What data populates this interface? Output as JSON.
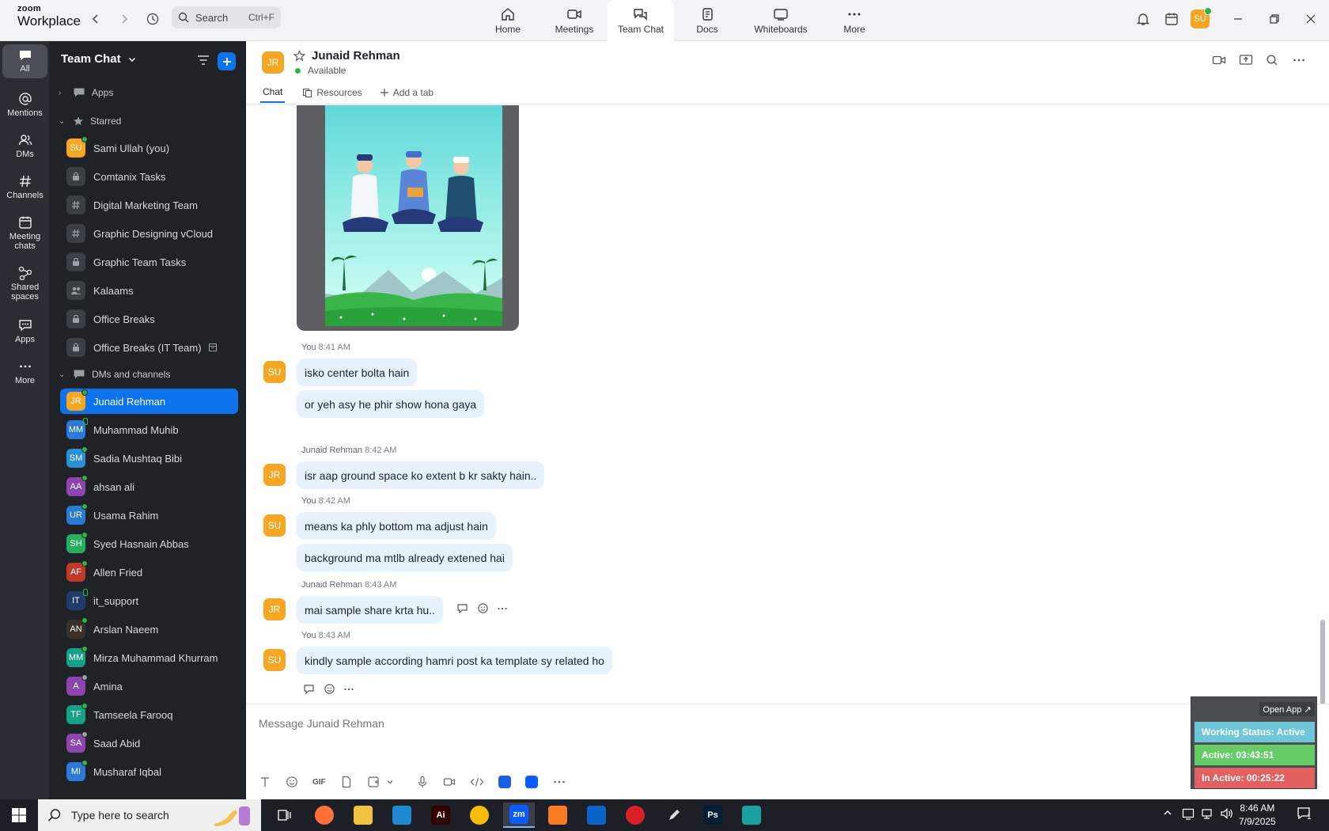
{
  "app": {
    "logo_line1": "zoom",
    "logo_line2": "Workplace",
    "search_placeholder": "Search",
    "search_shortcut": "Ctrl+F",
    "user_initials": "SU"
  },
  "nav_tabs": [
    {
      "label": "Home",
      "icon": "home-icon"
    },
    {
      "label": "Meetings",
      "icon": "video-icon"
    },
    {
      "label": "Team Chat",
      "icon": "chat-icon",
      "active": true
    },
    {
      "label": "Docs",
      "icon": "doc-icon"
    },
    {
      "label": "Whiteboards",
      "icon": "whiteboard-icon"
    },
    {
      "label": "More",
      "icon": "more-icon"
    }
  ],
  "rail": [
    {
      "label": "All",
      "icon": "chat-bubble-icon",
      "active": true
    },
    {
      "label": "Mentions",
      "icon": "at-icon"
    },
    {
      "label": "DMs",
      "icon": "people-icon"
    },
    {
      "label": "Channels",
      "icon": "hash-icon"
    },
    {
      "label": "Meeting chats",
      "icon": "calendar-icon"
    },
    {
      "label": "Shared spaces",
      "icon": "share-icon"
    },
    {
      "label": "Apps",
      "icon": "apps-icon"
    },
    {
      "label": "More",
      "icon": "more-icon"
    }
  ],
  "sidebar": {
    "title": "Team Chat",
    "sections": {
      "apps": "Apps",
      "starred": "Starred",
      "dms": "DMs and channels"
    },
    "starred": [
      {
        "name": "Sami Ullah (you)",
        "kind": "avatar",
        "initials": "SU",
        "color": "#f5a623",
        "status": "online"
      },
      {
        "name": "Comtanix Tasks",
        "kind": "lock"
      },
      {
        "name": "Digital Marketing Team",
        "kind": "hash"
      },
      {
        "name": "Graphic Designing vCloud",
        "kind": "hash"
      },
      {
        "name": "Graphic Team Tasks",
        "kind": "lock"
      },
      {
        "name": "Kalaams",
        "kind": "group"
      },
      {
        "name": "Office Breaks",
        "kind": "lock"
      },
      {
        "name": "Office Breaks (IT Team)",
        "kind": "lock"
      }
    ],
    "dms": [
      {
        "name": "Junaid Rehman",
        "initials": "JR",
        "color": "#f5a623",
        "status": "online",
        "selected": true
      },
      {
        "name": "Muhammad Muhib",
        "initials": "MM",
        "color": "#2b7bd6",
        "status": "phone"
      },
      {
        "name": "Sadia Mushtaq Bibi",
        "initials": "SM",
        "color": "#2b8fd6",
        "status": "online"
      },
      {
        "name": "ahsan ali",
        "initials": "AA",
        "color": "#8e44ad",
        "status": "online"
      },
      {
        "name": "Usama Rahim",
        "initials": "UR",
        "color": "#2b7bd6",
        "status": "online"
      },
      {
        "name": "Syed Hasnain Abbas",
        "initials": "SH",
        "color": "#27ae60",
        "status": "online"
      },
      {
        "name": "Allen Fried",
        "initials": "AF",
        "color": "#c0392b",
        "status": "online"
      },
      {
        "name": "it_support",
        "initials": "IT",
        "color": "#1e3d6b",
        "status": "phone"
      },
      {
        "name": "Arslan Naeem",
        "initials": "AN",
        "color": "#3b2f2a",
        "status": "online"
      },
      {
        "name": "Mirza Muhammad Khurram",
        "initials": "MM",
        "color": "#16a085",
        "status": "online"
      },
      {
        "name": "Amina",
        "initials": "A",
        "color": "#8e44ad",
        "status": "away"
      },
      {
        "name": "Tamseela Farooq",
        "initials": "TF",
        "color": "#16a085",
        "status": "online"
      },
      {
        "name": "Saad Abid",
        "initials": "SA",
        "color": "#8e44ad",
        "status": "away"
      },
      {
        "name": "Musharaf Iqbal",
        "initials": "MI",
        "color": "#2b7bd6",
        "status": "online"
      }
    ]
  },
  "channel": {
    "initials": "JR",
    "name": "Junaid Rehman",
    "status": "Available",
    "tabs": [
      "Chat",
      "Resources",
      "Add a tab"
    ]
  },
  "messages": [
    {
      "sender": "You",
      "time": "8:41 AM",
      "initials": "SU",
      "lines": [
        "isko center bolta hain",
        "or yeh asy he phir show hona gaya"
      ]
    },
    {
      "sender": "Junaid Rehman",
      "time": "8:42 AM",
      "initials": "JR",
      "lines": [
        "isr aap ground space ko extent b kr sakty hain.."
      ]
    },
    {
      "sender": "You",
      "time": "8:42 AM",
      "initials": "SU",
      "lines": [
        "means ka phly bottom ma adjust hain",
        "background ma mtlb already extened hai"
      ]
    },
    {
      "sender": "Junaid Rehman",
      "time": "8:43 AM",
      "initials": "JR",
      "lines": [
        "mai sample share krta hu.."
      ]
    },
    {
      "sender": "You",
      "time": "8:43 AM",
      "initials": "SU",
      "lines": [
        "kindly sample according hamri post ka template sy related ho"
      ]
    }
  ],
  "composer": {
    "placeholder": "Message Junaid Rehman",
    "gif_label": "GIF"
  },
  "widget": {
    "open_app": "Open App ↗",
    "working_status": "Working Status: Active",
    "active": "Active: 03:43:51",
    "inactive": "In Active: 00:25:22"
  },
  "taskbar": {
    "search_placeholder": "Type here to search",
    "time": "8:46 AM",
    "date": "7/9/2025",
    "notification_count": "1",
    "apps": [
      {
        "label": "",
        "icon": "task-view-icon",
        "color": "transparent"
      },
      {
        "label": "",
        "icon": "firefox-icon",
        "color": "#ff7139"
      },
      {
        "label": "",
        "icon": "folder-icon",
        "color": "#f3c33f"
      },
      {
        "label": "",
        "icon": "vscode-icon",
        "color": "#1f8ad2"
      },
      {
        "label": "Ai",
        "icon": "illustrator-icon",
        "color": "#330000"
      },
      {
        "label": "",
        "icon": "chrome-icon",
        "color": "#fbbc05"
      },
      {
        "label": "zm",
        "icon": "zoom-icon",
        "color": "#0b5cff"
      },
      {
        "label": "",
        "icon": "xampp-icon",
        "color": "#fb7a24"
      },
      {
        "label": "",
        "icon": "outlook-icon",
        "color": "#0a64c8"
      },
      {
        "label": "",
        "icon": "creative-cloud-icon",
        "color": "#da1f26"
      },
      {
        "label": "",
        "icon": "pen-icon",
        "color": "transparent"
      },
      {
        "label": "Ps",
        "icon": "photoshop-icon",
        "color": "#001e36"
      },
      {
        "label": "",
        "icon": "app-diamond-icon",
        "color": "#1aa0a0"
      }
    ]
  }
}
